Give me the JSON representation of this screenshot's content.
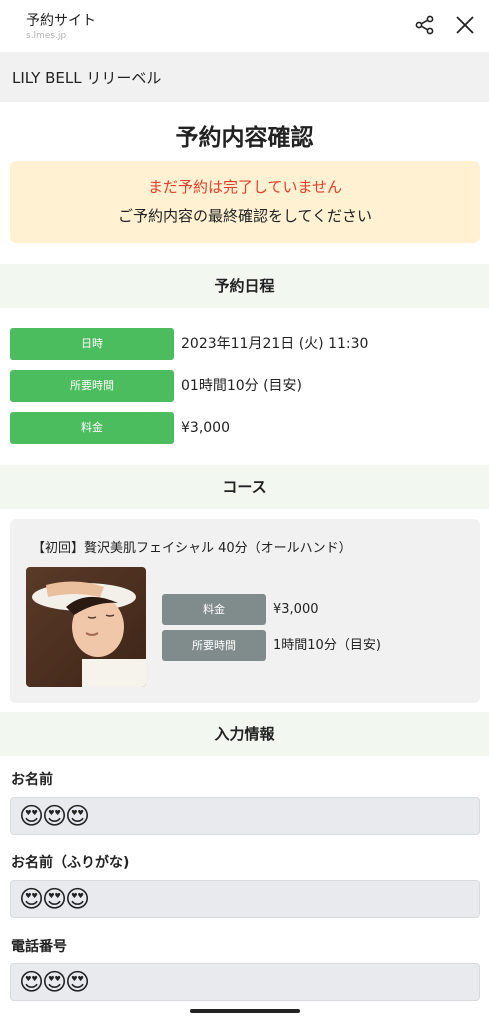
{
  "browser": {
    "title": "予約サイト",
    "url": "s.lmes.jp",
    "share_icon": "share-icon",
    "close_icon": "close-icon"
  },
  "shop": {
    "name": "LILY BELL リリーベル"
  },
  "page": {
    "title": "予約内容確認"
  },
  "notice": {
    "warning": "まだ予約は完了していません",
    "message": "ご予約内容の最終確認をしてください",
    "warning_color": "#e0402b",
    "background": "#fff1d2"
  },
  "schedule": {
    "heading": "予約日程",
    "rows": [
      {
        "label": "日時",
        "value": "2023年11月21日 (火) 11:30"
      },
      {
        "label": "所要時間",
        "value": "01時間10分 (目安)"
      },
      {
        "label": "料金",
        "value": "¥3,000"
      }
    ],
    "label_color": "#4cbd5f"
  },
  "course": {
    "heading": "コース",
    "name": "【初回】贅沢美肌フェイシャル 40分（オールハンド）",
    "rows": [
      {
        "label": "料金",
        "value": "¥3,000"
      },
      {
        "label": "所要時間",
        "value": "1時間10分（目安)"
      }
    ]
  },
  "input_info": {
    "heading": "入力情報",
    "fields": [
      {
        "label": "お名前",
        "value": "😍😍😍"
      },
      {
        "label": "お名前（ふりがな)",
        "value": "😍😍😍"
      },
      {
        "label": "電話番号",
        "value": "😍😍😍"
      }
    ]
  }
}
